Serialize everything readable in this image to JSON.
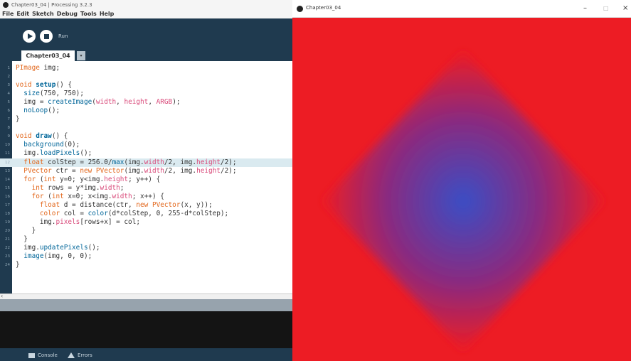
{
  "ide": {
    "title": "Chapter03_04 | Processing 3.2.3",
    "menu": [
      "File",
      "Edit",
      "Sketch",
      "Debug",
      "Tools",
      "Help"
    ],
    "toolbar": {
      "run_label": "Run"
    },
    "tab": {
      "name": "Chapter03_04",
      "menu_glyph": "▾"
    },
    "code_lines": [
      {
        "n": "1",
        "html": "<span class=\"k\">PImage</span> img;"
      },
      {
        "n": "2",
        "html": ""
      },
      {
        "n": "3",
        "html": "<span class=\"k\">void</span> <span class=\"f\">setup</span>() {"
      },
      {
        "n": "4",
        "html": "  <span class=\"b\">size</span>(750, 750);"
      },
      {
        "n": "5",
        "html": "  img = <span class=\"b\">createImage</span>(<span class=\"p\">width</span>, <span class=\"p\">height</span>, <span class=\"p\">ARGB</span>);"
      },
      {
        "n": "6",
        "html": "  <span class=\"b\">noLoop</span>();"
      },
      {
        "n": "7",
        "html": "}"
      },
      {
        "n": "8",
        "html": ""
      },
      {
        "n": "9",
        "html": "<span class=\"k\">void</span> <span class=\"f\">draw</span>() {"
      },
      {
        "n": "10",
        "html": "  <span class=\"b\">background</span>(0);"
      },
      {
        "n": "11",
        "html": "  img.<span class=\"b\">loadPixels</span>();"
      },
      {
        "n": "12",
        "html": "  <span class=\"k\">float</span> colStep = 256.0/<span class=\"b\">max</span>(img.<span class=\"p\">width</span>/2, img.<span class=\"p\">height</span>/2);",
        "highlight": true
      },
      {
        "n": "13",
        "html": "  <span class=\"k\">PVector</span> ctr = <span class=\"k\">new</span> <span class=\"k\">PVector</span>(img.<span class=\"p\">width</span>/2, img.<span class=\"p\">height</span>/2);"
      },
      {
        "n": "14",
        "html": "  <span class=\"k\">for</span> (<span class=\"k\">int</span> y=0; y&lt;img.<span class=\"p\">height</span>; y++) {"
      },
      {
        "n": "15",
        "html": "    <span class=\"k\">int</span> rows = y*img.<span class=\"p\">width</span>;"
      },
      {
        "n": "16",
        "html": "    <span class=\"k\">for</span> (<span class=\"k\">int</span> x=0; x&lt;img.<span class=\"p\">width</span>; x++) {"
      },
      {
        "n": "17",
        "html": "      <span class=\"k\">float</span> d = distance(ctr, <span class=\"k\">new</span> <span class=\"k\">PVector</span>(x, y));"
      },
      {
        "n": "18",
        "html": "      <span class=\"k\">color</span> col = <span class=\"b\">color</span>(d*colStep, 0, 255-d*colStep);"
      },
      {
        "n": "19",
        "html": "      img.<span class=\"p\">pixels</span>[rows+x] = col;"
      },
      {
        "n": "20",
        "html": "    }"
      },
      {
        "n": "21",
        "html": "  }"
      },
      {
        "n": "22",
        "html": "  img.<span class=\"b\">updatePixels</span>();"
      },
      {
        "n": "23",
        "html": "  <span class=\"b\">image</span>(img, 0, 0);"
      },
      {
        "n": "24",
        "html": "}"
      }
    ],
    "footer": {
      "console_label": "Console",
      "errors_label": "Errors"
    }
  },
  "sketch": {
    "title": "Chapter03_04",
    "controls": {
      "minimize": "–",
      "maximize": "□",
      "close": "×"
    },
    "colors": {
      "center": "#3a4ec5",
      "mid": "#8a2a7f",
      "edge": "#ed1c24"
    }
  }
}
